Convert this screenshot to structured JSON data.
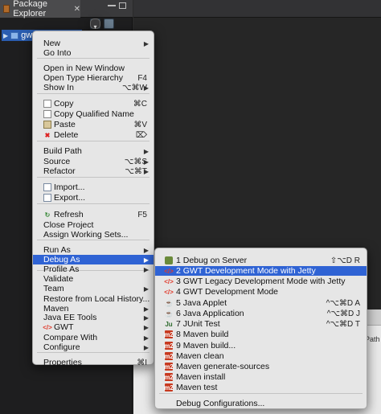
{
  "explorer": {
    "tab_title": "Package Explorer",
    "tab_close": "✕",
    "view_menu_glyph": "▾",
    "project_label": "gwt"
  },
  "bottom_panel": {
    "path_label": "Path"
  },
  "context_menu": {
    "items": [
      {
        "label": "New",
        "shortcut": "",
        "submenu": true
      },
      {
        "label": "Go Into",
        "shortcut": "",
        "submenu": false
      },
      {
        "label": "Open in New Window",
        "shortcut": "",
        "submenu": false
      },
      {
        "label": "Open Type Hierarchy",
        "shortcut": "F4",
        "submenu": false
      },
      {
        "label": "Show In",
        "shortcut": "⌥⌘W",
        "submenu": true
      },
      {
        "label": "Copy",
        "shortcut": "⌘C",
        "icon": "copy-icon"
      },
      {
        "label": "Copy Qualified Name",
        "shortcut": "",
        "icon": "copy-icon"
      },
      {
        "label": "Paste",
        "shortcut": "⌘V",
        "icon": "paste-icon"
      },
      {
        "label": "Delete",
        "shortcut": "⌦",
        "icon": "delete-icon"
      },
      {
        "label": "Build Path",
        "shortcut": "",
        "submenu": true
      },
      {
        "label": "Source",
        "shortcut": "⌥⌘S",
        "submenu": true
      },
      {
        "label": "Refactor",
        "shortcut": "⌥⌘T",
        "submenu": true
      },
      {
        "label": "Import...",
        "shortcut": "",
        "icon": "import-icon"
      },
      {
        "label": "Export...",
        "shortcut": "",
        "icon": "export-icon"
      },
      {
        "label": "Refresh",
        "shortcut": "F5",
        "icon": "refresh-icon"
      },
      {
        "label": "Close Project",
        "shortcut": ""
      },
      {
        "label": "Assign Working Sets...",
        "shortcut": ""
      },
      {
        "label": "Run As",
        "shortcut": "",
        "submenu": true
      },
      {
        "label": "Debug As",
        "shortcut": "",
        "submenu": true,
        "active": true
      },
      {
        "label": "Profile As",
        "shortcut": "",
        "submenu": true
      },
      {
        "label": "Validate",
        "shortcut": ""
      },
      {
        "label": "Team",
        "shortcut": "",
        "submenu": true
      },
      {
        "label": "Restore from Local History...",
        "shortcut": ""
      },
      {
        "label": "Maven",
        "shortcut": "",
        "submenu": true
      },
      {
        "label": "Java EE Tools",
        "shortcut": "",
        "submenu": true
      },
      {
        "label": "GWT",
        "shortcut": "",
        "submenu": true,
        "icon": "gwt-icon"
      },
      {
        "label": "Compare With",
        "shortcut": "",
        "submenu": true
      },
      {
        "label": "Configure",
        "shortcut": "",
        "submenu": true
      },
      {
        "label": "Properties",
        "shortcut": "⌘I"
      }
    ]
  },
  "debug_submenu": {
    "items": [
      {
        "label": "1 Debug on Server",
        "shortcut": "⇧⌥D R",
        "icon": "server-debug-icon"
      },
      {
        "label": "2 GWT Development Mode with Jetty",
        "shortcut": "",
        "icon": "gwt-icon",
        "active": true
      },
      {
        "label": "3 GWT Legacy Development Mode with Jetty",
        "shortcut": "",
        "icon": "gwt-icon"
      },
      {
        "label": "4 GWT Development Mode",
        "shortcut": "",
        "icon": "gwt-icon"
      },
      {
        "label": "5 Java Applet",
        "shortcut": "^⌥⌘D A",
        "icon": "java-applet-icon"
      },
      {
        "label": "6 Java Application",
        "shortcut": "^⌥⌘D J",
        "icon": "java-app-icon"
      },
      {
        "label": "7 JUnit Test",
        "shortcut": "^⌥⌘D T",
        "icon": "junit-icon"
      },
      {
        "label": "8 Maven build",
        "shortcut": "",
        "icon": "maven-icon"
      },
      {
        "label": "9 Maven build...",
        "shortcut": "",
        "icon": "maven-icon"
      },
      {
        "label": "Maven clean",
        "shortcut": "",
        "icon": "maven-icon"
      },
      {
        "label": "Maven generate-sources",
        "shortcut": "",
        "icon": "maven-icon"
      },
      {
        "label": "Maven install",
        "shortcut": "",
        "icon": "maven-icon"
      },
      {
        "label": "Maven test",
        "shortcut": "",
        "icon": "maven-icon"
      },
      {
        "label": "Debug Configurations...",
        "shortcut": ""
      }
    ]
  }
}
